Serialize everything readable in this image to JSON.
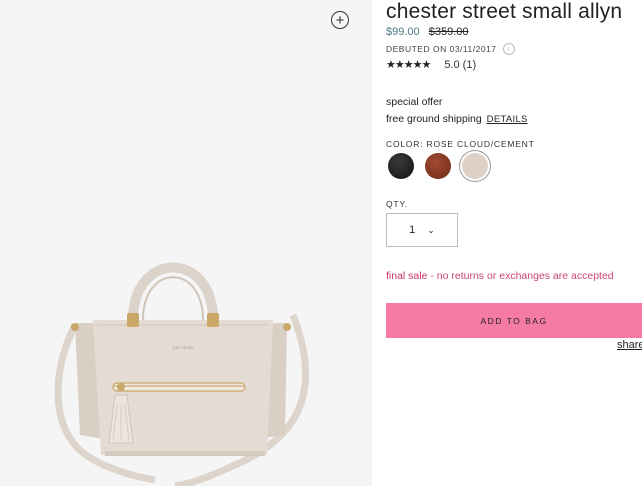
{
  "product": {
    "title": "chester street small allyn",
    "sale_price": "$99.00",
    "original_price": "$359.00",
    "debut": "DEBUTED ON 03/11/2017",
    "rating_stars": "★★★★★",
    "rating_text": "5.0  (1)"
  },
  "offer": {
    "title": "special offer",
    "text": "free ground shipping",
    "link": "DETAILS"
  },
  "color": {
    "label": "COLOR: ROSE CLOUD/CEMENT",
    "swatches": [
      {
        "name": "black",
        "hex": "#1a1a1a"
      },
      {
        "name": "brown",
        "hex": "#8a3a24"
      },
      {
        "name": "rose cloud/cement",
        "hex": "#ddd1c8",
        "selected": true
      }
    ]
  },
  "quantity": {
    "label": "QTY.",
    "value": "1"
  },
  "notice": {
    "strong": "final sale",
    "rest": " - no returns or exchanges are accepted"
  },
  "actions": {
    "add_to_bag": "ADD TO BAG",
    "share": "share"
  },
  "icons": {
    "zoom": "plus-circle-icon",
    "info": "info-icon",
    "caret": "chevron-down-icon"
  },
  "colors": {
    "accent_pink": "#f57ba4",
    "sale_teal": "#4a7a82",
    "final_sale_red": "#c8305e"
  }
}
